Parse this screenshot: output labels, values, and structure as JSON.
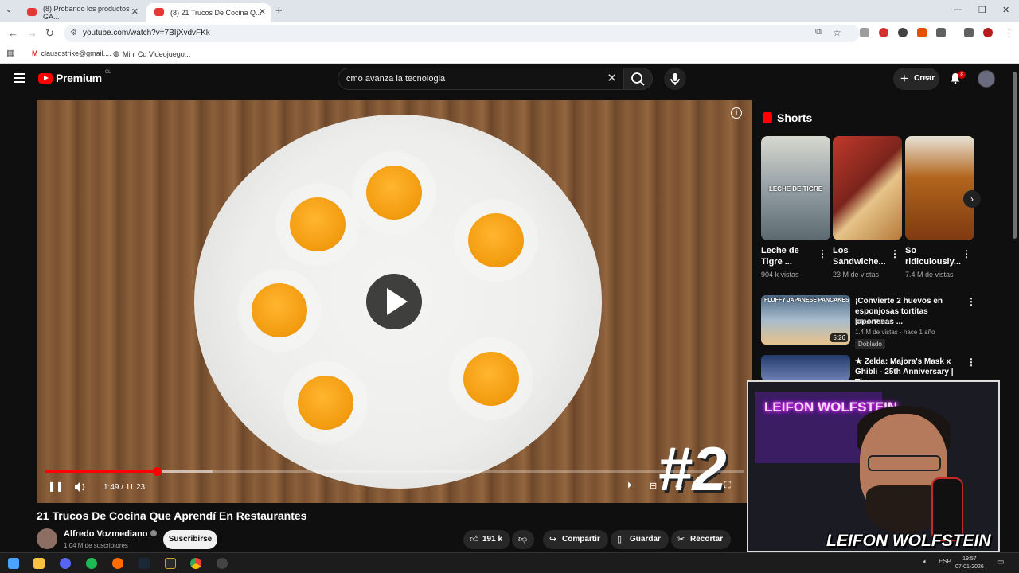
{
  "browser": {
    "tabs": [
      {
        "label": "(8) Probando los productos GA..."
      },
      {
        "label": "(8) 21 Trucos De Cocina Q..."
      }
    ],
    "url": "youtube.com/watch?v=7BIjXvdvFKk",
    "bookmarks": [
      {
        "label": "clausdstrike@gmail...."
      },
      {
        "label": "Mini Cd Videojuego..."
      }
    ]
  },
  "youtube": {
    "logo_text": "Premium",
    "logo_region": "CL",
    "search_value": "cmo avanza la tecnologia",
    "create_label": "Crear",
    "notifications_count": "8"
  },
  "player": {
    "time": "1:49 / 11:23",
    "progress": 0.16,
    "overlay_number": "#2"
  },
  "video": {
    "title": "21 Trucos De Cocina Que Aprendí En Restaurantes",
    "channel": "Alfredo Vozmediano",
    "subscribers": "1.04 M de suscriptores",
    "subscribe_label": "Suscribirse",
    "likes": "191 k",
    "share_label": "Compartir",
    "save_label": "Guardar",
    "clip_label": "Recortar"
  },
  "sidebar": {
    "shorts_heading": "Shorts",
    "shorts": [
      {
        "title": "Leche de Tigre ...",
        "views": "904 k vistas",
        "overlay": "LECHE DE TIGRE"
      },
      {
        "title": "Los Sandwiche...",
        "views": "23 M de vistas",
        "overlay": ""
      },
      {
        "title": "So ridiculously...",
        "views": "7.4 M de vistas",
        "overlay": ""
      }
    ],
    "recommendations": [
      {
        "title": "¡Convierte 2 huevos en esponjosas tortitas japonesas ...",
        "channel": "Whisk Takers",
        "meta": "1.4 M de vistas · hace 1 año",
        "duration": "5:26",
        "badge": "Doblado",
        "thumb_text": "FLUFFY JAPANESE PANCAKES"
      },
      {
        "title": "★ Zelda: Majora's Mask x Ghibli - 25th Anniversary | The ..."
      }
    ]
  },
  "webcam": {
    "neon_text": "LEIFON WOLFSTEIN",
    "watermark": "LEIFON WOLFSTEIN"
  },
  "taskbar": {
    "language": "ESP",
    "time": "19:57",
    "date": "07-01-2026"
  }
}
